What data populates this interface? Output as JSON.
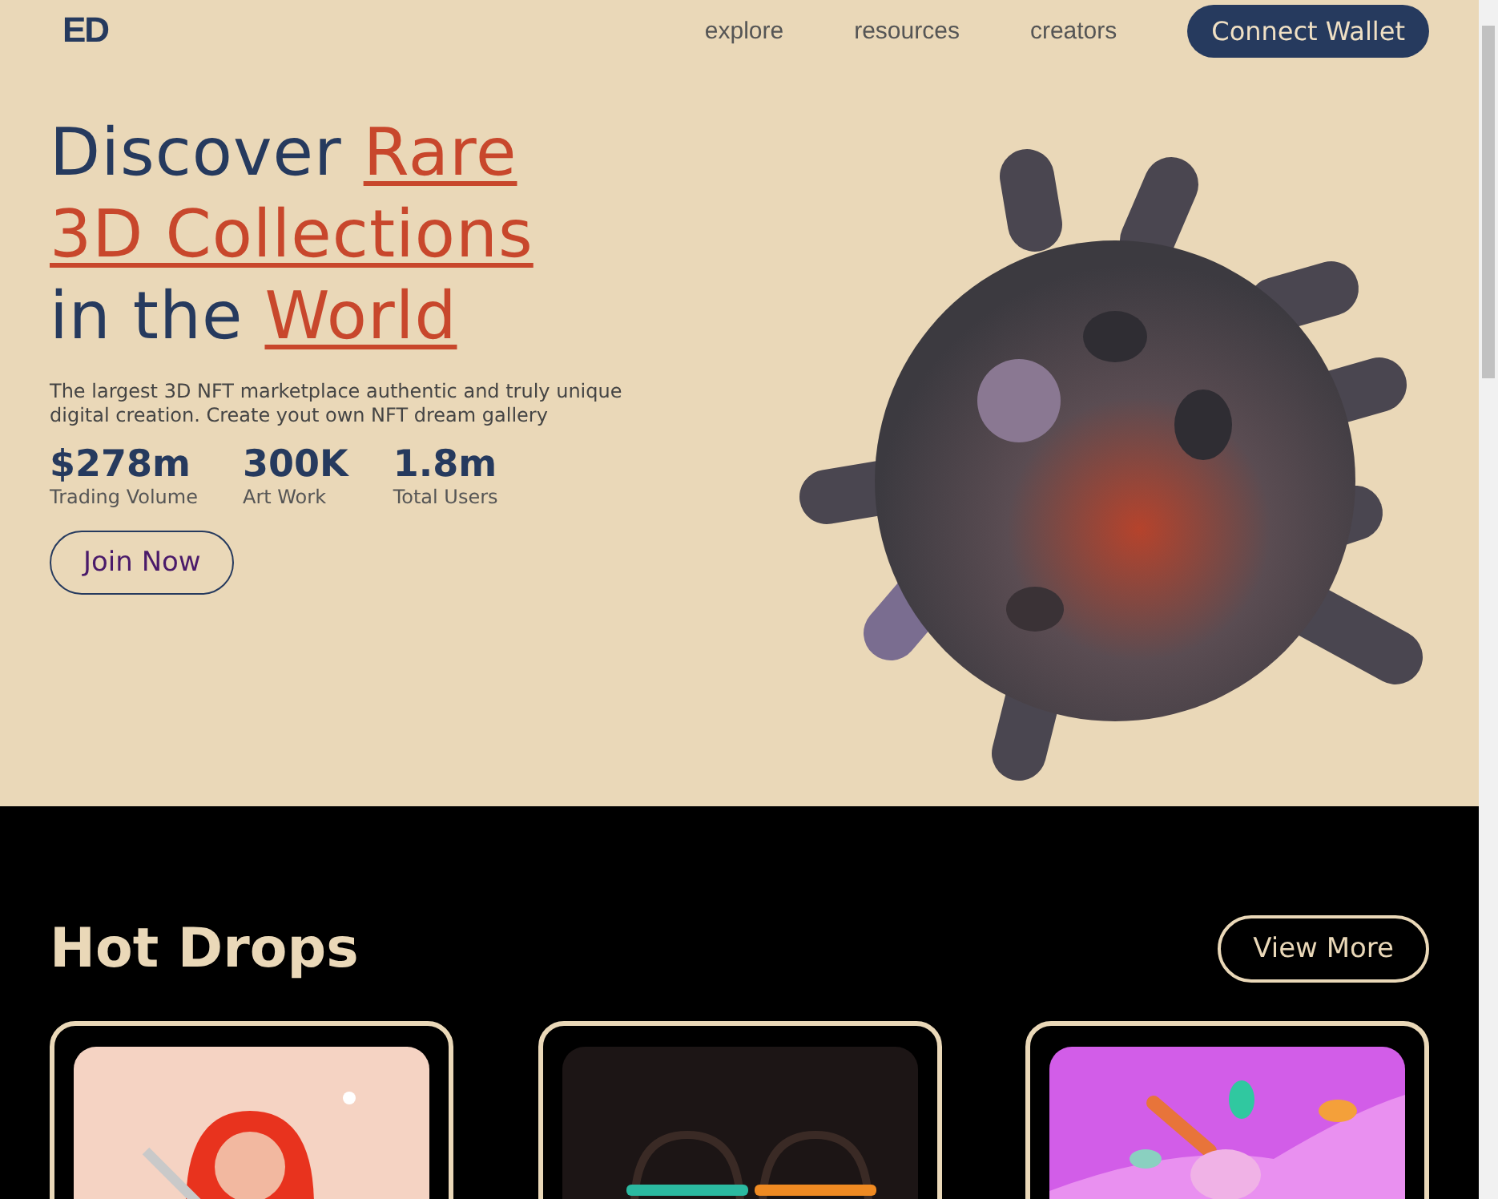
{
  "nav": {
    "logo": "ED",
    "links": [
      "explore",
      "resources",
      "creators"
    ],
    "cta": "Connect Wallet"
  },
  "hero": {
    "heading": [
      [
        {
          "text": "Discover ",
          "highlight": false
        },
        {
          "text": "Rare",
          "highlight": true
        }
      ],
      [
        {
          "text": "3D Collections",
          "highlight": true
        }
      ],
      [
        {
          "text": "in the ",
          "highlight": false
        },
        {
          "text": "World",
          "highlight": true
        }
      ]
    ],
    "description": "The largest 3D NFT marketplace authentic and truly unique digital creation. Create yout own NFT dream gallery",
    "stats": [
      {
        "value": "$278m",
        "label": "Trading Volume"
      },
      {
        "value": "300K",
        "label": "Art Work"
      },
      {
        "value": "1.8m",
        "label": "Total Users"
      }
    ],
    "button": "Join Now",
    "image": {
      "kind": "picture"
    }
  },
  "hot_drops": {
    "title": "Hot Drops",
    "button": "View More",
    "cards": [
      {
        "kind": "picture"
      },
      {
        "kind": "picture"
      },
      {
        "kind": "picture"
      }
    ]
  }
}
